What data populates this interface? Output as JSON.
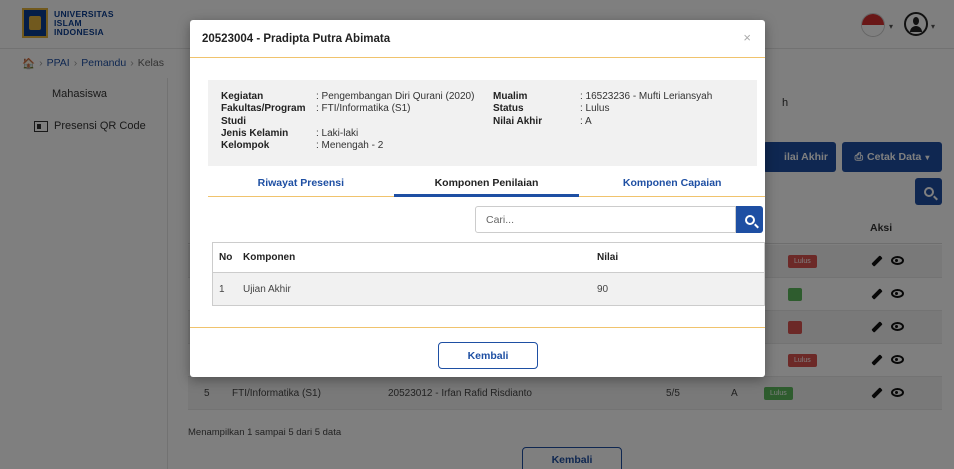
{
  "app": {
    "logo_text_1": "UNIVERSITAS",
    "logo_text_2": "ISLAM",
    "logo_text_3": "INDONESIA"
  },
  "breadcrumb": [
    "PPAI",
    "Pemandu",
    "Kelas"
  ],
  "sidebar": {
    "items": [
      {
        "label": "Mahasiswa",
        "icon": "user-icon"
      },
      {
        "label": "Presensi QR Code",
        "icon": "qr-code-icon"
      }
    ]
  },
  "background": {
    "peek_text": "h",
    "nilai_button": "ilai Akhir",
    "cetak_button": "Cetak Data",
    "aksi_header": "Aksi",
    "row5": {
      "no": "5",
      "prodi": "FTI/Informatika (S1)",
      "mahasiswa": "20523012 - Irfan Rafid Risdianto",
      "presensi": "5/5",
      "nilai": "A",
      "status": "Lulus"
    },
    "badge_lulus": "Lulus",
    "footer_note": "Menampilkan 1 sampai 5 dari 5 data",
    "kembali_label": "Kembali"
  },
  "modal": {
    "title": "20523004 - Pradipta Putra Abimata",
    "close_symbol": "×",
    "info_left": [
      {
        "label": "Kegiatan",
        "value": ": Pengembangan Diri Qurani (2020)"
      },
      {
        "label": "Fakultas/Program Studi",
        "value": ": FTI/Informatika (S1)"
      },
      {
        "label": "Jenis Kelamin",
        "value": ": Laki-laki"
      },
      {
        "label": "Kelompok",
        "value": ": Menengah - 2"
      }
    ],
    "info_right": [
      {
        "label": "Mualim",
        "value": ": 16523236 - Mufti Leriansyah"
      },
      {
        "label": "Status",
        "value": ": Lulus"
      },
      {
        "label": "Nilai Akhir",
        "value": ": A"
      }
    ],
    "tabs": [
      {
        "label": "Riwayat Presensi",
        "active": false
      },
      {
        "label": "Komponen Penilaian",
        "active": true
      },
      {
        "label": "Komponen Capaian",
        "active": false
      }
    ],
    "search": {
      "placeholder": "Cari...",
      "value": ""
    },
    "table": {
      "headers": [
        "No",
        "Komponen",
        "Nilai"
      ],
      "rows": [
        {
          "no": "1",
          "komponen": "Ujian Akhir",
          "nilai": "90"
        }
      ]
    },
    "kembali_label": "Kembali"
  },
  "colors": {
    "primary": "#1e4fa3",
    "accent_line": "#f0c36d",
    "badge_red": "#d9534f",
    "badge_green": "#5cb85c"
  }
}
